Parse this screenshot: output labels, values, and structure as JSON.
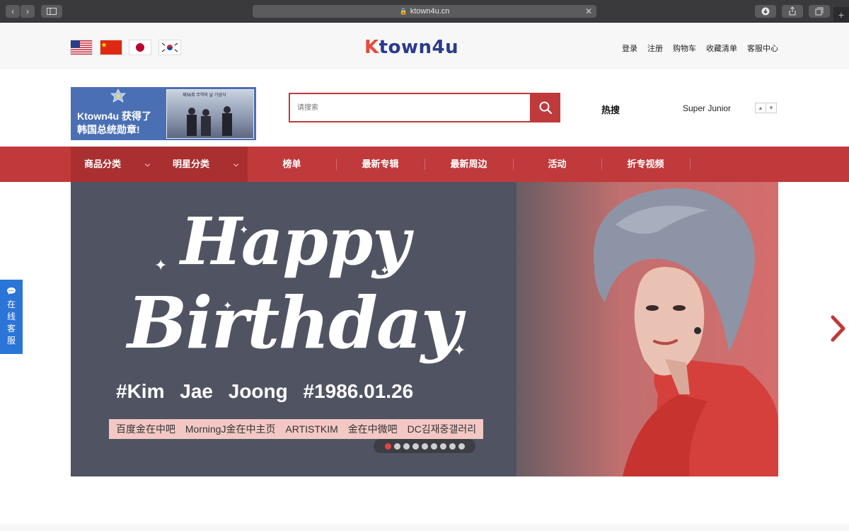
{
  "browser": {
    "url": "ktown4u.cn",
    "tabs_icon": "sidebar-icon",
    "back_icon": "chevron-left-icon",
    "forward_icon": "chevron-right-icon"
  },
  "header": {
    "flags": [
      "us-flag",
      "china-flag",
      "japan-flag",
      "korea-flag"
    ],
    "logo_first": "K",
    "logo_rest": "town4u",
    "links": [
      "登录",
      "注册",
      "购物车",
      "收藏清单",
      "客服中心"
    ]
  },
  "promo": {
    "line1": "Ktown4u 获得了",
    "line2": "韩国总统勋章!",
    "photo_title": "제56회 무역의 날 기념식"
  },
  "search": {
    "placeholder": "请搜索",
    "hot_label": "热搜",
    "hot_value": "Super Junior",
    "up": "▲",
    "down": "▼"
  },
  "nav": {
    "items": [
      {
        "label": "商品分类"
      },
      {
        "label": "明星分类"
      },
      {
        "label": "榜单"
      },
      {
        "label": "最新专辑"
      },
      {
        "label": "最新周边"
      },
      {
        "label": "活动"
      },
      {
        "label": "折专视频"
      }
    ]
  },
  "banner": {
    "happy": "Happy",
    "birthday": "Birthday",
    "hashtag_name": "#Kim Jae Joong",
    "hashtag_date": "#1986.01.26",
    "fan_links": [
      "百度金在中吧",
      "MorningJ金在中主页",
      "ARTISTKIM",
      "金在中微吧",
      "DC김재중갤러리"
    ],
    "slide_count": 9,
    "active_slide": 1
  },
  "chat": {
    "label_chars": [
      "在",
      "线",
      "客",
      "服"
    ]
  },
  "colors": {
    "brand_red": "#c0393b",
    "nav_dark": "#a92f30",
    "chat_blue": "#2b74d8"
  }
}
